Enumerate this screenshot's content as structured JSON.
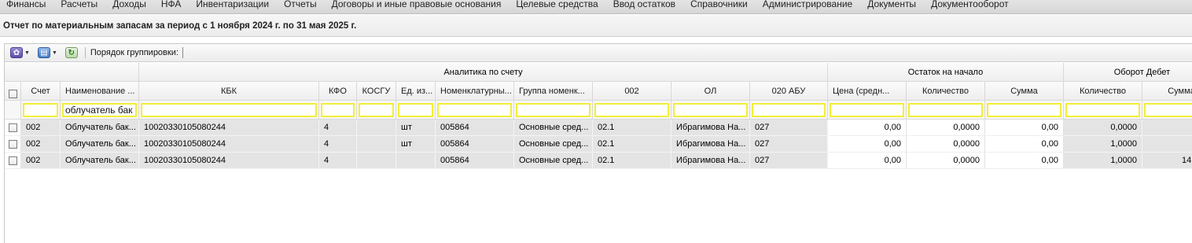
{
  "menu": [
    "Финансы",
    "Расчеты",
    "Доходы",
    "НФА",
    "Инвентаризации",
    "Отчеты",
    "Договоры и иные правовые основания",
    "Целевые средства",
    "Ввод остатков",
    "Справочники",
    "Администрирование",
    "Документы",
    "Документооборот"
  ],
  "title": "Отчет по материальным запасам за период с 1 ноября 2024 г. по 31 мая 2025 г.",
  "toolbar": {
    "settings_icon": "gear-icon",
    "print_icon": "print-icon",
    "refresh_icon": "refresh-icon",
    "grouping_label": "Порядок группировки:"
  },
  "groups": {
    "analytics": "Аналитика по счету",
    "opening": "Остаток на начало",
    "debit": "Оборот Дебет"
  },
  "columns": {
    "account": "Счет",
    "name": "Наименование ...",
    "kbk": "КБК",
    "kfo": "КФО",
    "kosgu": "КОСГУ",
    "unit": "Ед. из...",
    "nomenclature": "Номенклатурны...",
    "group": "Группа номенк...",
    "c002": "002",
    "ol": "ОЛ",
    "abu": "020 АБУ",
    "price": "Цена (средн...",
    "qty_open": "Количество",
    "sum_open": "Сумма",
    "qty_debit": "Количество",
    "sum_debit": "Сумма"
  },
  "filter": {
    "name_value": "облучатель бак"
  },
  "rows": [
    {
      "account": "002",
      "name": "Облучатель бак...",
      "kbk": "10020330105080244",
      "kfo": "4",
      "kosgu": "",
      "unit": "шт",
      "nomenclature": "005864",
      "group": "Основные сред...",
      "c002": "02.1",
      "ol": "Ибрагимова На...",
      "abu": "027",
      "price": "0,00",
      "qty_open": "0,0000",
      "sum_open": "0,00",
      "qty_debit": "0,0000",
      "sum_debit": ""
    },
    {
      "account": "002",
      "name": "Облучатель бак...",
      "kbk": "10020330105080244",
      "kfo": "4",
      "kosgu": "",
      "unit": "шт",
      "nomenclature": "005864",
      "group": "Основные сред...",
      "c002": "02.1",
      "ol": "Ибрагимова На...",
      "abu": "027",
      "price": "0,00",
      "qty_open": "0,0000",
      "sum_open": "0,00",
      "qty_debit": "1,0000",
      "sum_debit": ""
    },
    {
      "account": "002",
      "name": "Облучатель бак...",
      "kbk": "10020330105080244",
      "kfo": "4",
      "kosgu": "",
      "unit": "",
      "nomenclature": "005864",
      "group": "Основные сред...",
      "c002": "02.1",
      "ol": "Ибрагимова На...",
      "abu": "027",
      "price": "0,00",
      "qty_open": "0,0000",
      "sum_open": "0,00",
      "qty_debit": "1,0000",
      "sum_debit": "14"
    }
  ]
}
